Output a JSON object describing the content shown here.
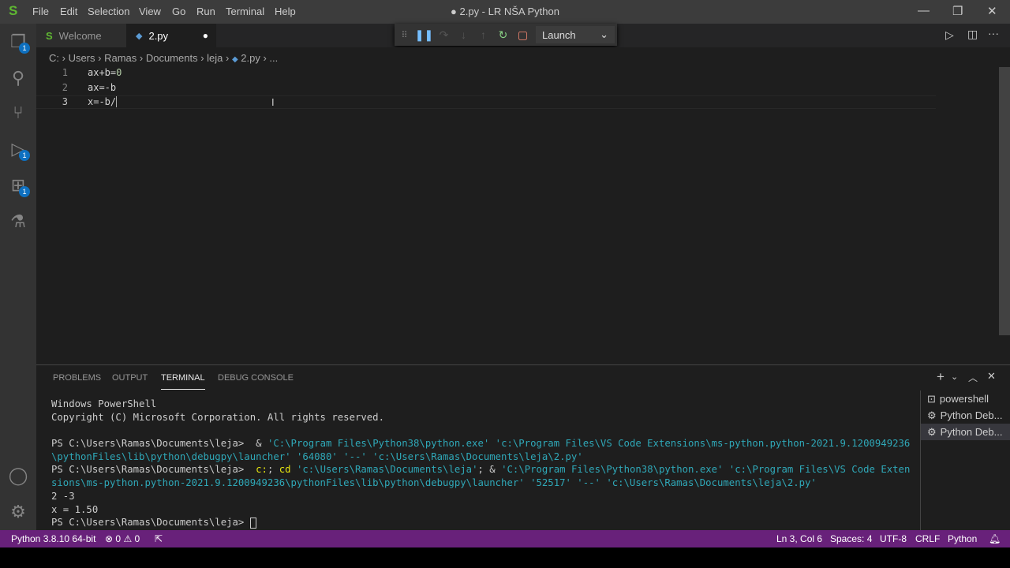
{
  "titlebar": {
    "title": "● 2.py - LR NŠA Python",
    "menu": [
      "File",
      "Edit",
      "Selection",
      "View",
      "Go",
      "Run",
      "Terminal",
      "Help"
    ]
  },
  "activity": {
    "badges": {
      "explorer": "1",
      "debug": "1",
      "extensions": "1"
    }
  },
  "tabs": [
    {
      "label": "Welcome"
    },
    {
      "label": "2.py",
      "dirty": "●"
    }
  ],
  "breadcrumb": [
    "C:",
    "Users",
    "Ramas",
    "Documents",
    "leja",
    "2.py",
    "..."
  ],
  "debug": {
    "config": "Launch"
  },
  "editor": {
    "lines": [
      {
        "n": "1",
        "text": "ax+b=",
        "num": "0"
      },
      {
        "n": "2",
        "text": "ax=-b",
        "num": ""
      },
      {
        "n": "3",
        "text": "x=-b/",
        "num": ""
      }
    ]
  },
  "panel": {
    "tabs": [
      "PROBLEMS",
      "OUTPUT",
      "TERMINAL",
      "DEBUG CONSOLE"
    ],
    "terminals": [
      "powershell",
      "Python Deb...",
      "Python Deb..."
    ],
    "lines": [
      [
        {
          "t": "Windows PowerShell",
          "c": ""
        }
      ],
      [
        {
          "t": "Copyright (C) Microsoft Corporation. All rights reserved.",
          "c": ""
        }
      ],
      [
        {
          "t": "",
          "c": ""
        }
      ],
      [
        {
          "t": "PS C:\\Users\\Ramas\\Documents\\leja>  & ",
          "c": ""
        },
        {
          "t": "'C:\\Program Files\\Python38\\python.exe' 'c:\\Program Files\\VS Code Extensions\\ms-python.python-2021.9.1200949236",
          "c": "s"
        }
      ],
      [
        {
          "t": "\\pythonFiles\\lib\\python\\debugpy\\launcher' '64080' '--' 'c:\\Users\\Ramas\\Documents\\leja\\2.py'",
          "c": "s"
        }
      ],
      [
        {
          "t": "PS C:\\Users\\Ramas\\Documents\\leja>  ",
          "c": ""
        },
        {
          "t": "c:",
          "c": "y"
        },
        {
          "t": "; ",
          "c": ""
        },
        {
          "t": "cd",
          "c": "y"
        },
        {
          "t": " 'c:\\Users\\Ramas\\Documents\\leja'",
          "c": "s"
        },
        {
          "t": "; & ",
          "c": ""
        },
        {
          "t": "'C:\\Program Files\\Python38\\python.exe' 'c:\\Program Files\\VS Code Exten",
          "c": "s"
        }
      ],
      [
        {
          "t": "sions\\ms-python.python-2021.9.1200949236\\pythonFiles\\lib\\python\\debugpy\\launcher' '52517' '--' 'c:\\Users\\Ramas\\Documents\\leja\\2.py'",
          "c": "s"
        }
      ],
      [
        {
          "t": "2 -3",
          "c": ""
        }
      ],
      [
        {
          "t": "x = 1.50",
          "c": ""
        }
      ],
      [
        {
          "t": "PS C:\\Users\\Ramas\\Documents\\leja> ",
          "c": ""
        }
      ]
    ]
  },
  "status": {
    "interpreter": "Python 3.8.10 64-bit",
    "errors": "0",
    "warnings": "0",
    "position": "Ln 3, Col 6",
    "spaces": "Spaces: 4",
    "encoding": "UTF-8",
    "eol": "CRLF",
    "language": "Python"
  },
  "colors": {
    "status": "#68217a",
    "string": "#2fa8b8",
    "keyword": "#e5e510"
  }
}
